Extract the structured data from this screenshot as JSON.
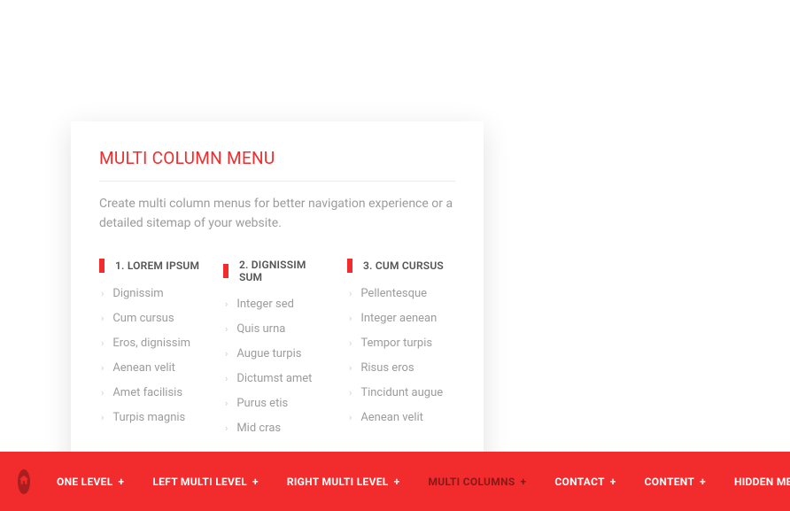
{
  "dropdown": {
    "title": "MULTI COLUMN MENU",
    "description": "Create multi column menus for better navigation experience or a detailed sitemap of your website.",
    "columns": [
      {
        "header": "1. LOREM IPSUM",
        "items": [
          "Dignissim",
          "Cum cursus",
          "Eros, dignissim",
          "Aenean velit",
          "Amet facilisis",
          "Turpis magnis"
        ]
      },
      {
        "header": "2. DIGNISSIM SUM",
        "items": [
          "Integer sed",
          "Quis urna",
          "Augue turpis",
          "Dictumst amet",
          "Purus etis",
          "Mid cras"
        ]
      },
      {
        "header": "3. CUM CURSUS",
        "items": [
          "Pellentesque",
          "Integer aenean",
          "Tempor turpis",
          "Risus eros",
          "Tincidunt augue",
          "Aenean velit"
        ]
      }
    ]
  },
  "nav": {
    "items": [
      {
        "label": "ONE LEVEL",
        "active": false
      },
      {
        "label": "LEFT MULTI LEVEL",
        "active": false
      },
      {
        "label": "RIGHT MULTI LEVEL",
        "active": false
      },
      {
        "label": "MULTI COLUMNS",
        "active": true
      },
      {
        "label": "CONTACT",
        "active": false
      },
      {
        "label": "CONTENT",
        "active": false
      },
      {
        "label": "HIDDEN MENU",
        "active": false
      }
    ]
  }
}
